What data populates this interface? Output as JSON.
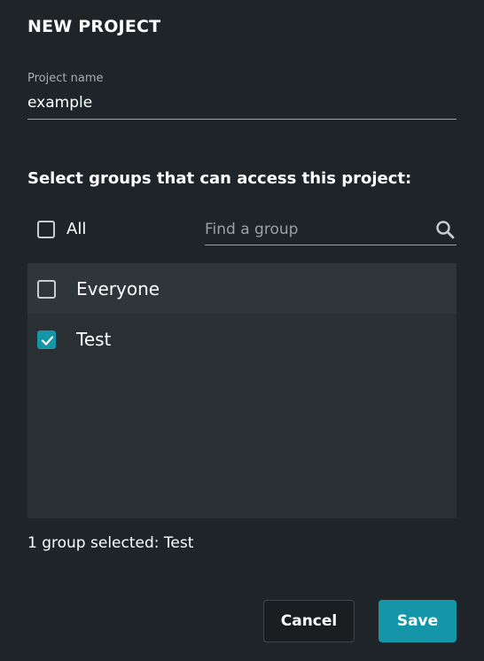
{
  "dialog": {
    "title": "NEW PROJECT"
  },
  "project_name": {
    "label": "Project name",
    "value": "example"
  },
  "groups_section": {
    "heading": "Select groups that can access this project:",
    "all_label": "All",
    "all_checked": false,
    "search": {
      "placeholder": "Find a group",
      "value": "",
      "icon": "search-icon"
    },
    "items": [
      {
        "label": "Everyone",
        "checked": false
      },
      {
        "label": "Test",
        "checked": true
      }
    ],
    "summary": "1 group selected: Test"
  },
  "actions": {
    "cancel_label": "Cancel",
    "save_label": "Save"
  },
  "colors": {
    "background": "#1f2428",
    "list_background": "#292f33",
    "accent": "#1596a8"
  }
}
